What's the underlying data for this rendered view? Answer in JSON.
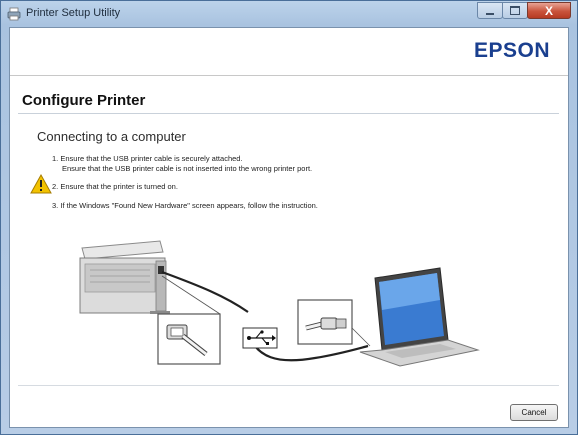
{
  "window": {
    "title": "Printer Setup Utility",
    "close_label": "X"
  },
  "brand": {
    "logo": "EPSON"
  },
  "page": {
    "heading": "Configure Printer",
    "subheading": "Connecting to a computer",
    "instructions": [
      {
        "number": "1.",
        "text": "Ensure that the USB printer cable is securely attached."
      },
      {
        "number": "",
        "text": "Ensure that the USB printer cable is not inserted into the wrong printer port."
      },
      {
        "number": "2.",
        "text": "Ensure that the printer is turned on."
      },
      {
        "number": "3.",
        "text": "If the Windows \"Found New Hardware\" screen appears, follow the instruction."
      }
    ]
  },
  "buttons": {
    "cancel": "Cancel"
  },
  "icons": {
    "warning": "warning-triangle-icon",
    "usb": "usb-symbol-icon"
  },
  "colors": {
    "logo": "#1a3f8f",
    "warning": "#f2c200",
    "title_bar": "#bcd3ea",
    "close_button": "#c9543c"
  }
}
